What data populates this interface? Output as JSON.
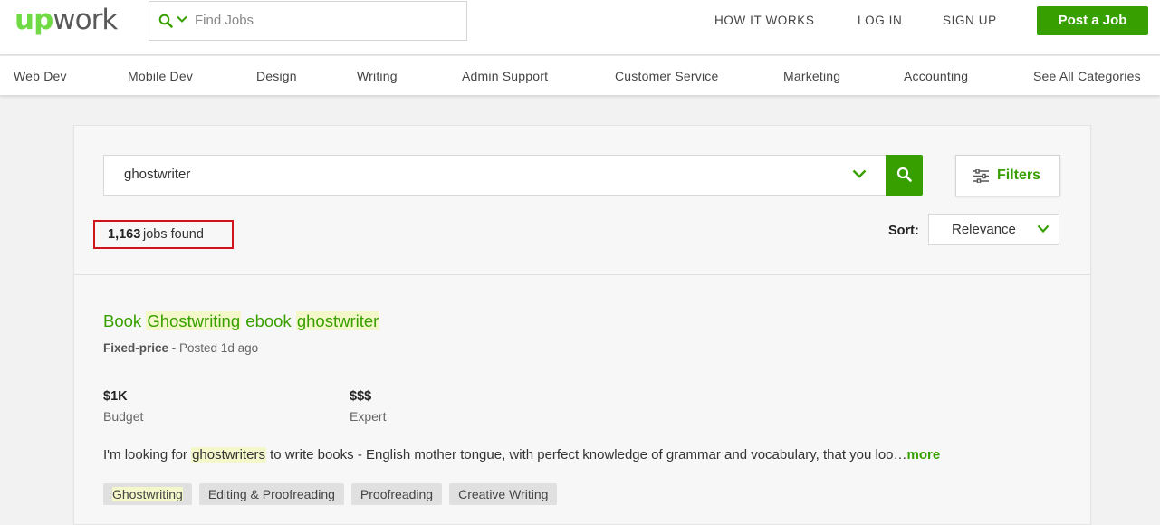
{
  "header": {
    "logo_up": "up",
    "logo_work": "work",
    "search_placeholder": "Find Jobs",
    "nav": [
      "HOW IT WORKS",
      "LOG IN",
      "SIGN UP"
    ],
    "post_job": "Post a Job"
  },
  "categories": [
    "Web Dev",
    "Mobile Dev",
    "Design",
    "Writing",
    "Admin Support",
    "Customer Service",
    "Marketing",
    "Accounting",
    "See All Categories"
  ],
  "search": {
    "query": "ghostwriter",
    "filters_label": "Filters",
    "results_count": "1,163",
    "results_suffix": "jobs found",
    "sort_label": "Sort:",
    "sort_value": "Relevance"
  },
  "job": {
    "title_parts": [
      "Book ",
      "Ghostwriting",
      " ebook ",
      "ghostwriter"
    ],
    "type": "Fixed-price",
    "posted": " - Posted 1d ago",
    "budget_value": "$1K",
    "budget_label": "Budget",
    "level_value": "$$$",
    "level_label": "Expert",
    "desc_pre": "I'm looking for ",
    "desc_highlight": "ghostwriters",
    "desc_post": " to write books - English mother tongue, with perfect knowledge of grammar and vocabulary, that you loo…",
    "more": "more",
    "tags": [
      "Ghostwriting",
      "Editing & Proofreading",
      "Proofreading",
      "Creative Writing"
    ]
  },
  "colors": {
    "brand_green": "#37a000",
    "logo_green": "#6fda44",
    "highlight_box": "#d0141c"
  }
}
